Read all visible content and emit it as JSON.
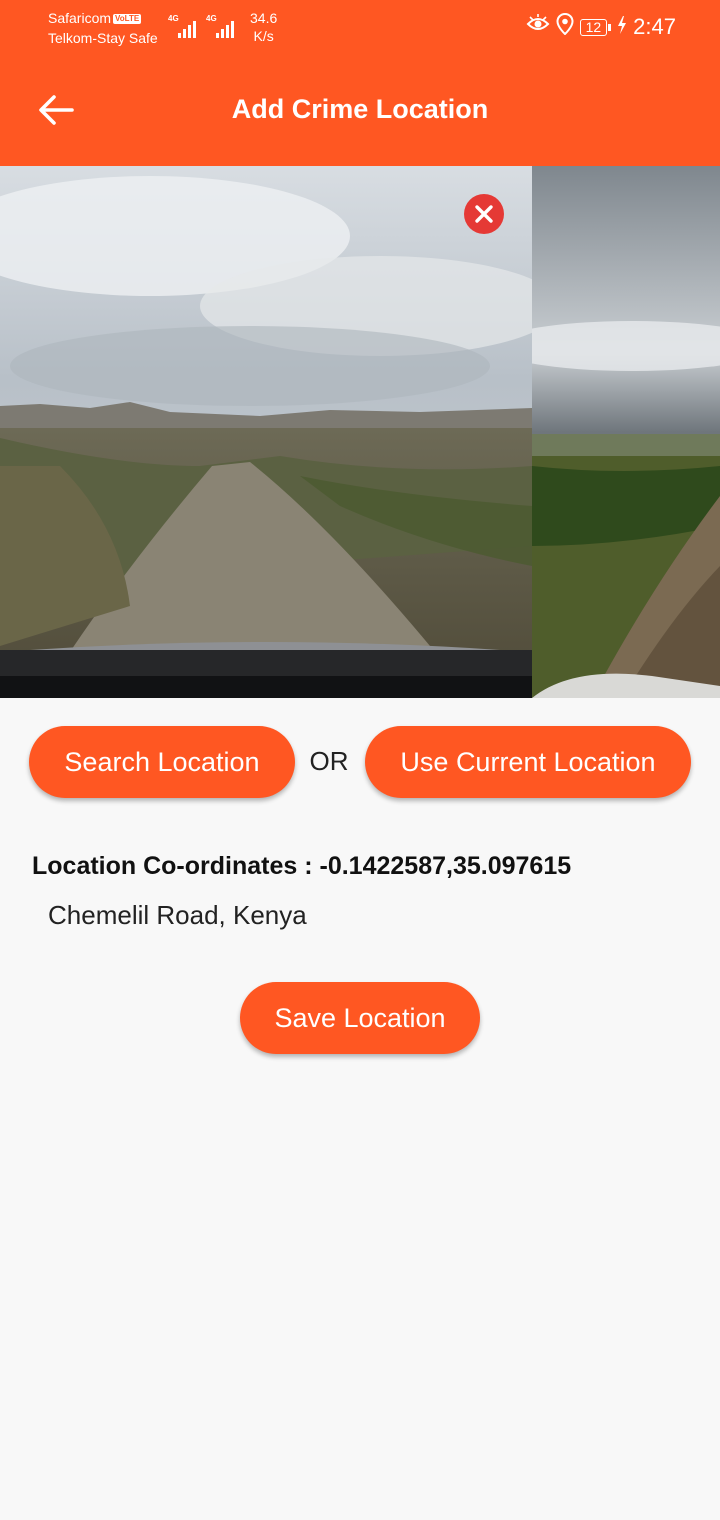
{
  "status_bar": {
    "carrier_1": "Safaricom",
    "carrier_1_badge": "VoLTE",
    "carrier_2": "Telkom-Stay Safe",
    "network_1": "4G",
    "network_2": "4G",
    "speed_value": "34.6",
    "speed_unit": "K/s",
    "battery": "12",
    "time": "2:47",
    "icons": [
      "eye-icon",
      "location-pin-icon",
      "battery-icon",
      "charging-icon"
    ]
  },
  "app_bar": {
    "title": "Add Crime Location",
    "back_icon": "arrow-left-icon"
  },
  "gallery": {
    "photos": [
      "road-photo",
      "field-photo"
    ],
    "remove_icon": "close-icon"
  },
  "actions": {
    "search_label": "Search Location",
    "or_label": "OR",
    "current_label": "Use Current Location",
    "save_label": "Save Location"
  },
  "location": {
    "coordinates_text": "Location Co-ordinates :  -0.1422587,35.097615",
    "address": "Chemelil Road, Kenya"
  },
  "colors": {
    "primary": "#ff5722",
    "remove_button": "#e53935",
    "background": "#f8f8f8"
  }
}
